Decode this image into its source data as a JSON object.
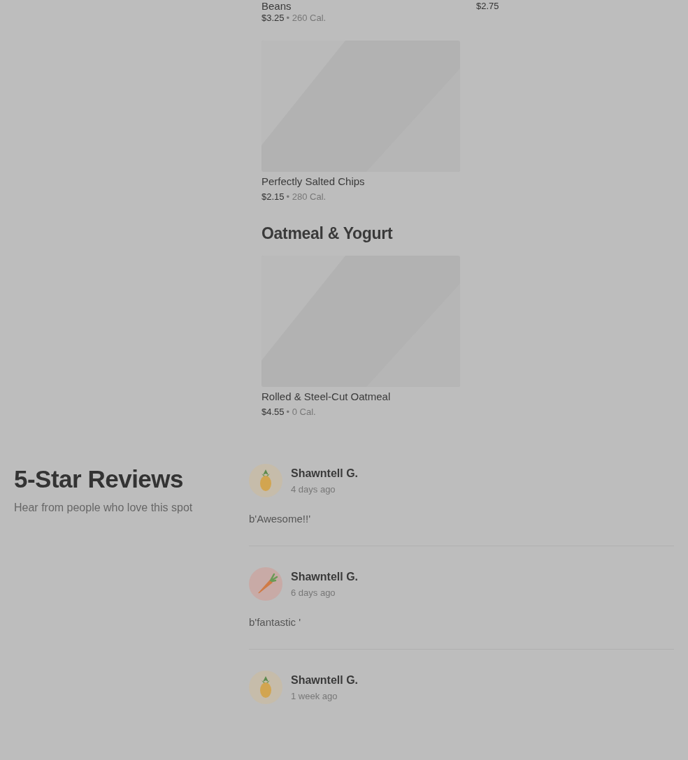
{
  "menu_rows": [
    {
      "items": [
        {
          "name": "Beans",
          "price": "$3.25",
          "calories": "• 260 Cal."
        },
        {
          "price": "$2.75"
        }
      ]
    },
    {
      "items": [
        {
          "name": "Perfectly Salted Chips",
          "price": "$2.15",
          "calories": "• 280 Cal.",
          "has_image": true
        }
      ]
    }
  ],
  "sections": [
    {
      "title": "Oatmeal & Yogurt",
      "items": [
        {
          "name": "Rolled & Steel-Cut Oatmeal",
          "price": "$4.55",
          "calories": "• 0 Cal.",
          "has_image": true
        }
      ]
    }
  ],
  "reviews_header": {
    "title": "5-Star Reviews",
    "subtitle": "Hear from people who love this spot"
  },
  "reviews": [
    {
      "name": "Shawntell G.",
      "time": "4 days ago",
      "text": "b'Awesome!!'",
      "kind": "pineapple"
    },
    {
      "name": "Shawntell G.",
      "time": "6 days ago",
      "text": "b'fantastic '",
      "kind": "carrot"
    },
    {
      "name": "Shawntell G.",
      "time": "1 week ago",
      "kind": "pineapple"
    }
  ]
}
